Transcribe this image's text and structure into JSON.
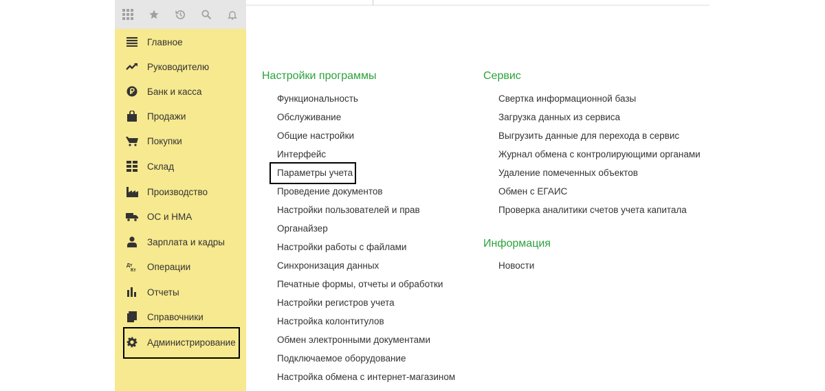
{
  "toolbar": {
    "icons": [
      "apps-grid-icon",
      "star-icon",
      "history-icon",
      "search-icon",
      "bell-icon"
    ]
  },
  "sidebar": {
    "items": [
      {
        "label": "Главное",
        "icon": "menu-lines-icon"
      },
      {
        "label": "Руководителю",
        "icon": "trend-up-icon"
      },
      {
        "label": "Банк и касса",
        "icon": "ruble-coin-icon"
      },
      {
        "label": "Продажи",
        "icon": "shopping-bag-icon"
      },
      {
        "label": "Покупки",
        "icon": "shopping-cart-icon"
      },
      {
        "label": "Склад",
        "icon": "warehouse-grid-icon"
      },
      {
        "label": "Производство",
        "icon": "factory-icon"
      },
      {
        "label": "ОС и НМА",
        "icon": "truck-icon"
      },
      {
        "label": "Зарплата и кадры",
        "icon": "person-icon"
      },
      {
        "label": "Операции",
        "icon": "dt-kt-icon"
      },
      {
        "label": "Отчеты",
        "icon": "bar-chart-icon"
      },
      {
        "label": "Справочники",
        "icon": "books-icon"
      },
      {
        "label": "Администрирование",
        "icon": "gear-icon"
      }
    ]
  },
  "main": {
    "settings": {
      "title": "Настройки программы",
      "links": [
        "Функциональность",
        "Обслуживание",
        "Общие настройки",
        "Интерфейс",
        "Параметры учета",
        "Проведение документов",
        "Настройки пользователей и прав",
        "Органайзер",
        "Настройки работы с файлами",
        "Синхронизация данных",
        "Печатные формы, отчеты и обработки",
        "Настройки регистров учета",
        "Настройка колонтитулов",
        "Обмен электронными документами",
        "Подключаемое оборудование",
        "Настройка обмена с интернет-магазином"
      ]
    },
    "service": {
      "title": "Сервис",
      "links": [
        "Свертка информационной базы",
        "Загрузка данных из сервиса",
        "Выгрузить данные для перехода в сервис",
        "Журнал обмена с контролирующими органами",
        "Удаление помеченных объектов",
        "Обмен с ЕГАИС",
        "Проверка аналитики счетов учета капитала"
      ]
    },
    "info": {
      "title": "Информация",
      "links": [
        "Новости"
      ]
    }
  },
  "colors": {
    "sidebar_bg": "#f7e98f",
    "toolbar_bg": "#e6e6e6",
    "section_title": "#2ba23a",
    "text": "#333333",
    "highlight_border": "#000000"
  }
}
